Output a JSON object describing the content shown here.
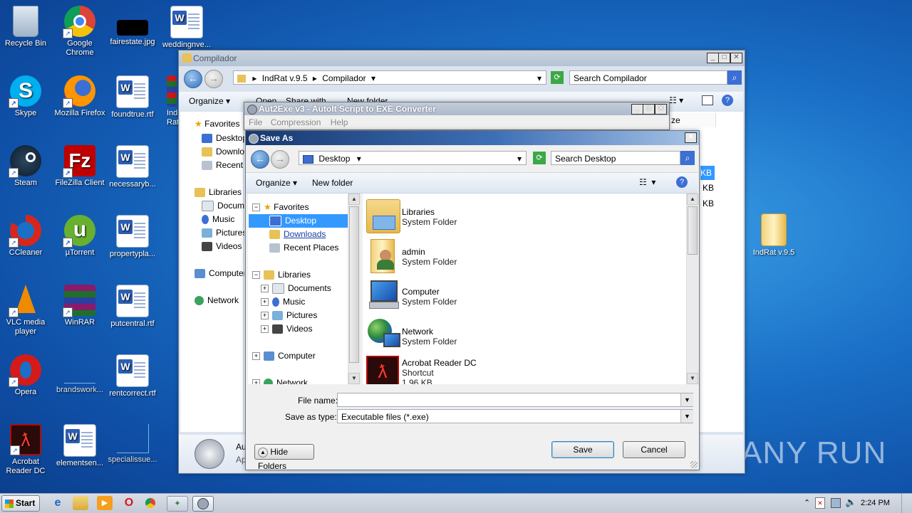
{
  "desktop": {
    "icons": [
      {
        "label": "Recycle Bin",
        "icon": "recycle-bin-icon"
      },
      {
        "label": "Google Chrome",
        "icon": "chrome-icon"
      },
      {
        "label": "fairestate.jpg",
        "icon": "image-file-icon"
      },
      {
        "label": "weddingnve...",
        "icon": "word-doc-icon"
      },
      {
        "label": "Skype",
        "icon": "skype-icon"
      },
      {
        "label": "Mozilla Firefox",
        "icon": "firefox-icon"
      },
      {
        "label": "foundtrue.rtf",
        "icon": "word-doc-icon"
      },
      {
        "label": "Inde Rat",
        "icon": "winrar-icon"
      },
      {
        "label": "Steam",
        "icon": "steam-icon"
      },
      {
        "label": "FileZilla Client",
        "icon": "filezilla-icon"
      },
      {
        "label": "necessaryb...",
        "icon": "word-doc-icon"
      },
      {
        "label": "CCleaner",
        "icon": "ccleaner-icon"
      },
      {
        "label": "µTorrent",
        "icon": "utorrent-icon"
      },
      {
        "label": "propertypla...",
        "icon": "word-doc-icon"
      },
      {
        "label": "VLC media player",
        "icon": "vlc-icon"
      },
      {
        "label": "WinRAR",
        "icon": "winrar-icon"
      },
      {
        "label": "putcentral.rtf",
        "icon": "word-doc-icon"
      },
      {
        "label": "Opera",
        "icon": "opera-icon"
      },
      {
        "label": "brandswork...",
        "icon": "blank-file-icon"
      },
      {
        "label": "rentcorrect.rtf",
        "icon": "word-doc-icon"
      },
      {
        "label": "Acrobat Reader DC",
        "icon": "acrobat-icon"
      },
      {
        "label": "elementsen...",
        "icon": "word-doc-icon"
      },
      {
        "label": "specialissue...",
        "icon": "blank-file-icon"
      },
      {
        "label": "IndRat v.9.5",
        "icon": "folder-icon"
      }
    ]
  },
  "explorer": {
    "title": "Compilador",
    "breadcrumb": [
      "IndRat v.9.5",
      "Compilador"
    ],
    "search_placeholder": "Search Compilador",
    "toolbar": {
      "organize": "Organize",
      "open": "Open",
      "share": "Share with",
      "new_folder": "New folder"
    },
    "nav": {
      "favorites": "Favorites",
      "desktop": "Desktop",
      "downloads": "Downlo",
      "recent": "Recent",
      "libraries": "Libraries",
      "documents": "Docume",
      "music": "Music",
      "pictures": "Pictures",
      "videos": "Videos",
      "computer": "Computer",
      "network": "Network"
    },
    "col_header": "ze",
    "sizes": [
      "KB",
      "KB",
      "KB"
    ],
    "details_name": "Au",
    "details_type": "Ap"
  },
  "aut2exe": {
    "title": "Aut2Exe v3 - AutoIt Script to EXE Converter",
    "menu": [
      "File",
      "Compression",
      "Help"
    ]
  },
  "saveas": {
    "title": "Save As",
    "location": "Desktop",
    "search_placeholder": "Search Desktop",
    "toolbar": {
      "organize": "Organize",
      "new_folder": "New folder"
    },
    "tree": {
      "favorites": "Favorites",
      "desktop": "Desktop",
      "downloads": "Downloads",
      "recent_places": "Recent Places",
      "libraries": "Libraries",
      "documents": "Documents",
      "music": "Music",
      "pictures": "Pictures",
      "videos": "Videos",
      "computer": "Computer",
      "network": "Network"
    },
    "items": [
      {
        "name": "Libraries",
        "type": "System Folder"
      },
      {
        "name": "admin",
        "type": "System Folder"
      },
      {
        "name": "Computer",
        "type": "System Folder"
      },
      {
        "name": "Network",
        "type": "System Folder"
      },
      {
        "name": "Acrobat Reader DC",
        "type": "Shortcut",
        "size": "1.96 KB"
      }
    ],
    "file_name_label": "File name:",
    "file_name_value": "",
    "save_type_label": "Save as type:",
    "save_type_value": "Executable files (*.exe)",
    "hide_folders": "Hide Folders",
    "save": "Save",
    "cancel": "Cancel"
  },
  "watermark": "ANY RUN",
  "taskbar": {
    "start": "Start",
    "time": "2:24 PM"
  },
  "colors": {
    "accent": "#3399ff",
    "selection": "#3399ff",
    "title_active": "#1f4c8f"
  }
}
